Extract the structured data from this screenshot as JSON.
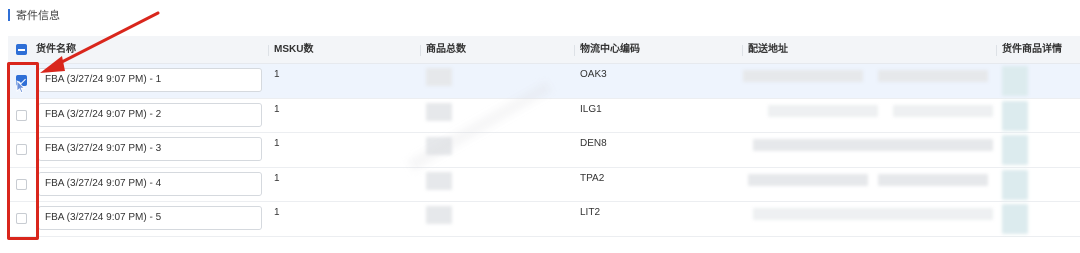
{
  "section": {
    "title": "寄件信息"
  },
  "table": {
    "columns": {
      "name": "货件名称",
      "msku": "MSKU数",
      "total": "商品总数",
      "center": "物流中心编码",
      "address": "配送地址",
      "detail": "货件商品详情"
    },
    "rows": [
      {
        "name": "FBA (3/27/24 9:07 PM) - 1",
        "msku": "1",
        "center": "OAK3",
        "checked": true
      },
      {
        "name": "FBA (3/27/24 9:07 PM) - 2",
        "msku": "1",
        "center": "ILG1",
        "checked": false
      },
      {
        "name": "FBA (3/27/24 9:07 PM) - 3",
        "msku": "1",
        "center": "DEN8",
        "checked": false
      },
      {
        "name": "FBA (3/27/24 9:07 PM) - 4",
        "msku": "1",
        "center": "TPA2",
        "checked": false
      },
      {
        "name": "FBA (3/27/24 9:07 PM) - 5",
        "msku": "1",
        "center": "LIT2",
        "checked": false
      }
    ]
  },
  "colors": {
    "accent": "#2f6fd6",
    "annotation": "#d9261c",
    "selected_row": "#eef4fd"
  }
}
